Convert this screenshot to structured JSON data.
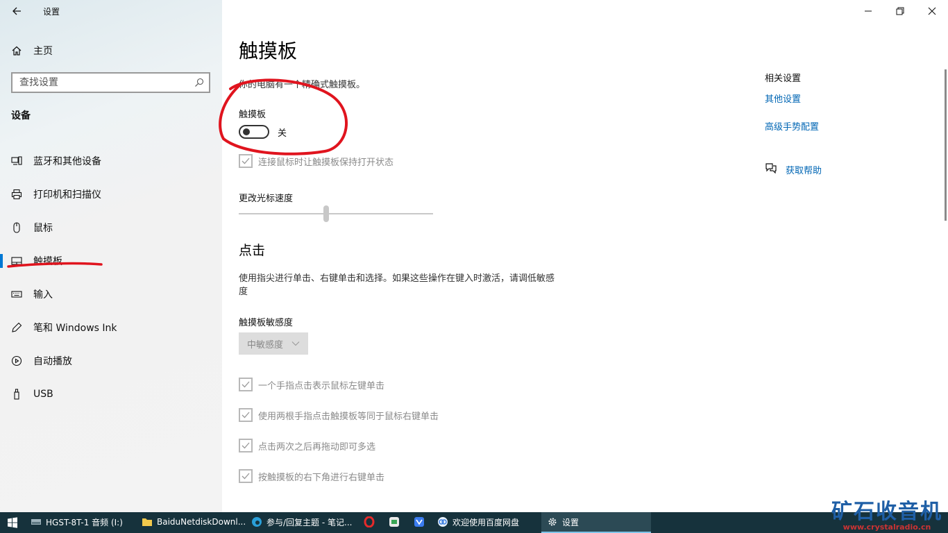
{
  "window": {
    "title": "设置",
    "back_icon": "back-arrow-icon"
  },
  "sidebar": {
    "home_label": "主页",
    "search_placeholder": "查找设置",
    "section_title": "设备",
    "items": [
      {
        "label": "蓝牙和其他设备",
        "icon": "bluetooth-devices-icon"
      },
      {
        "label": "打印机和扫描仪",
        "icon": "printer-icon"
      },
      {
        "label": "鼠标",
        "icon": "mouse-icon"
      },
      {
        "label": "触摸板",
        "icon": "touchpad-icon",
        "selected": true
      },
      {
        "label": "输入",
        "icon": "keyboard-icon"
      },
      {
        "label": "笔和 Windows Ink",
        "icon": "pen-icon"
      },
      {
        "label": "自动播放",
        "icon": "autoplay-icon"
      },
      {
        "label": "USB",
        "icon": "usb-icon"
      }
    ]
  },
  "main": {
    "title": "触摸板",
    "description": "你的电脑有一个精确式触摸板。",
    "touchpad_label": "触摸板",
    "touchpad_toggle_state": "关",
    "touchpad_toggle_on": false,
    "keep_on_with_mouse_label": "连接鼠标时让触摸板保持打开状态",
    "cursor_speed_label": "更改光标速度",
    "cursor_speed_value": 0.45,
    "taps_header": "点击",
    "taps_description": "使用指尖进行单击、右键单击和选择。如果这些操作在键入时激活，请调低敏感度",
    "sensitivity_label": "触摸板敏感度",
    "sensitivity_value": "中敏感度",
    "tap_options": [
      {
        "label": "一个手指点击表示鼠标左键单击",
        "checked": true
      },
      {
        "label": "使用两根手指点击触摸板等同于鼠标右键单击",
        "checked": true
      },
      {
        "label": "点击两次之后再拖动即可多选",
        "checked": true
      },
      {
        "label": "按触摸板的右下角进行右键单击",
        "checked": true
      }
    ]
  },
  "related": {
    "title": "相关设置",
    "links": [
      "其他设置",
      "高级手势配置"
    ],
    "help_label": "获取帮助"
  },
  "taskbar": {
    "items": [
      {
        "label": "HGST-8T-1 音频 (I:)",
        "icon": "drive-icon"
      },
      {
        "label": "BaiduNetdiskDownl...",
        "icon": "folder-icon"
      },
      {
        "label": "参与/回复主题 - 笔记...",
        "icon": "edge-browser-icon"
      },
      {
        "label": "",
        "icon": "opera-icon"
      },
      {
        "label": "",
        "icon": "wechat-icon"
      },
      {
        "label": "",
        "icon": "feishu-icon"
      },
      {
        "label": "欢迎使用百度网盘",
        "icon": "baidu-netdisk-icon"
      },
      {
        "label": "设置",
        "icon": "gear-icon",
        "active": true
      }
    ]
  },
  "watermark": {
    "title": "矿石收音机",
    "url": "www.crystalradio.cn"
  },
  "colors": {
    "accent": "#0078d4",
    "link": "#0066b4",
    "annotation": "#e0141e",
    "taskbar": "#16323c"
  }
}
